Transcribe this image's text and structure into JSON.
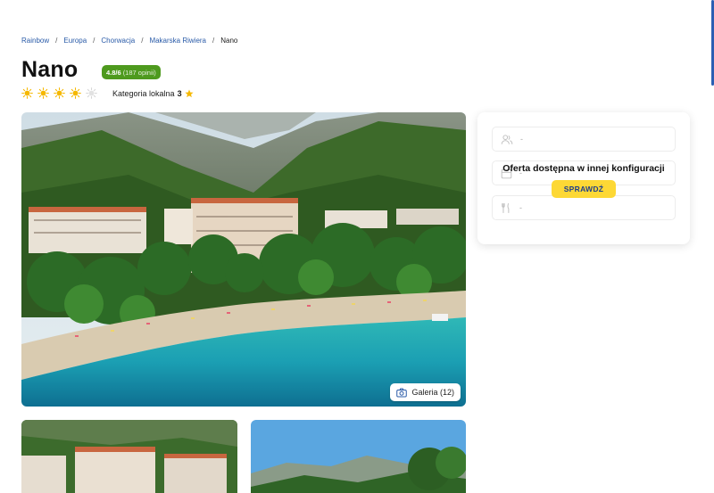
{
  "breadcrumb": {
    "items": [
      "Rainbow",
      "Europa",
      "Chorwacja",
      "Makarska Riwiera"
    ],
    "separator": "/",
    "current": "Nano"
  },
  "hotel": {
    "name": "Nano",
    "rating_score": "4.8/6",
    "rating_count": "(187 opinii)",
    "suns_filled": 4,
    "suns_total": 5,
    "category_label": "Kategoria lokalna",
    "category_value": "3"
  },
  "gallery": {
    "label": "Galeria (12)"
  },
  "booking": {
    "guests_value": "-",
    "date_value": "-",
    "meal_value": "-",
    "message": "Oferta dostępna w innej konfiguracji",
    "button_label": "SPRAWDŹ"
  },
  "colors": {
    "link": "#2a5ba8",
    "rating_badge": "#4e9a1e",
    "cta": "#fdd835",
    "cta_text": "#1e3f8a",
    "sun": "#f5b800"
  }
}
